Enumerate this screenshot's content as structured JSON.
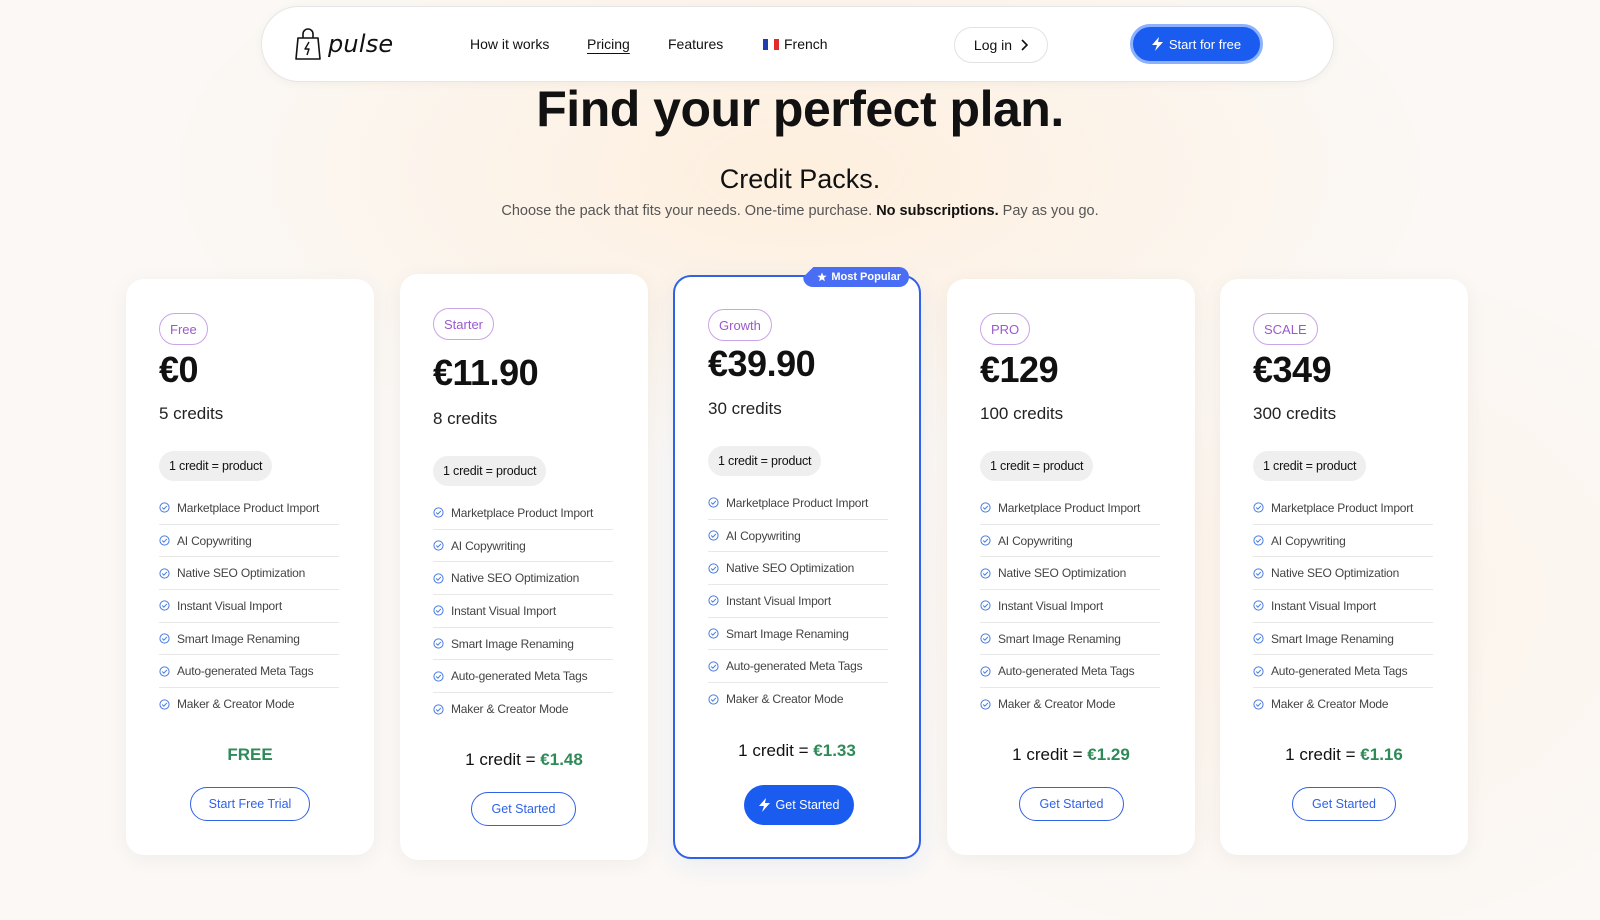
{
  "nav": {
    "logo_text": "pulse",
    "links": [
      "How it works",
      "Pricing",
      "Features"
    ],
    "language": "French",
    "login_label": "Log in",
    "start_label": "Start for free"
  },
  "hero": {
    "title": "Find your perfect plan.",
    "subtitle": "Credit Packs.",
    "desc_before": "Choose the pack that fits your needs. One-time purchase. ",
    "desc_bold": "No subscriptions.",
    "desc_after": " Pay as you go."
  },
  "colors": {
    "accent": "#1a5cf0",
    "price_green": "#2e8b57",
    "tier_purple": "#9b59d0"
  },
  "features": [
    "Marketplace Product Import",
    "AI Copywriting",
    "Native SEO Optimization",
    "Instant Visual Import",
    "Smart Image Renaming",
    "Auto-generated Meta Tags",
    "Maker & Creator Mode"
  ],
  "plans": [
    {
      "tier": "Free",
      "price": "€0",
      "credits": "5 credits",
      "unit": "1 credit = product",
      "ratio_label": "FREE",
      "cta": "Start Free Trial"
    },
    {
      "tier": "Starter",
      "price": "€11.90",
      "credits": "8 credits",
      "unit": "1 credit = product",
      "ratio_prefix": "1 credit = ",
      "ratio_value": "€1.48",
      "cta": "Get Started"
    },
    {
      "tier": "Growth",
      "price": "€39.90",
      "credits": "30 credits",
      "unit": "1 credit = product",
      "ratio_prefix": "1 credit = ",
      "ratio_value": "€1.33",
      "cta": "Get Started",
      "badge": "Most Popular"
    },
    {
      "tier": "PRO",
      "price": "€129",
      "credits": "100 credits",
      "unit": "1 credit = product",
      "ratio_prefix": "1 credit = ",
      "ratio_value": "€1.29",
      "cta": "Get Started"
    },
    {
      "tier": "SCALE",
      "price": "€349",
      "credits": "300 credits",
      "unit": "1 credit = product",
      "ratio_prefix": "1 credit = ",
      "ratio_value": "€1.16",
      "cta": "Get Started"
    }
  ]
}
